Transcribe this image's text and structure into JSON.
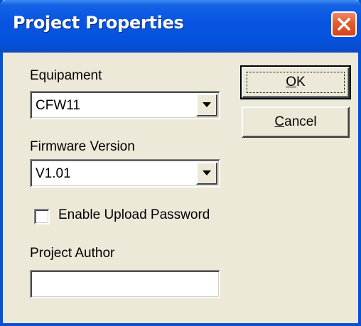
{
  "window": {
    "title": "Project Properties"
  },
  "fields": {
    "equipment": {
      "label": "Equipament",
      "value": "CFW11"
    },
    "firmware": {
      "label": "Firmware Version",
      "value": "V1.01"
    },
    "upload_password": {
      "label": "Enable Upload Password",
      "checked": false
    },
    "author": {
      "label": "Project Author",
      "value": ""
    }
  },
  "buttons": {
    "ok": {
      "mnemonic": "O",
      "rest": "K"
    },
    "cancel": {
      "mnemonic": "C",
      "rest": "ancel"
    }
  },
  "icons": {
    "close": "close-icon",
    "dropdown": "chevron-down-icon"
  },
  "colors": {
    "titlebar": "#0654e0",
    "close_button": "#e25b2e",
    "dialog_background": "#ece9d8"
  }
}
